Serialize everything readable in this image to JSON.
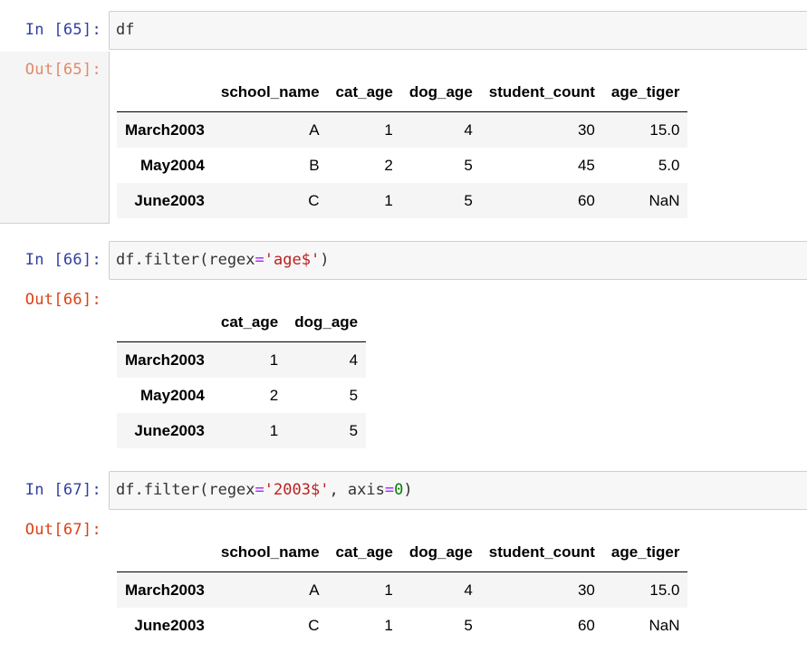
{
  "cells": [
    {
      "in_prompt": "In [65]:",
      "code_tokens": [
        {
          "text": "df",
          "kind": "plain"
        }
      ],
      "out_prompt": "Out[65]:",
      "table": {
        "columns": [
          "",
          "school_name",
          "cat_age",
          "dog_age",
          "student_count",
          "age_tiger"
        ],
        "rows": [
          [
            "March2003",
            "A",
            "1",
            "4",
            "30",
            "15.0"
          ],
          [
            "May2004",
            "B",
            "2",
            "5",
            "45",
            "5.0"
          ],
          [
            "June2003",
            "C",
            "1",
            "5",
            "60",
            "NaN"
          ]
        ]
      }
    },
    {
      "in_prompt": "In [66]:",
      "code_tokens": [
        {
          "text": "df.filter(regex",
          "kind": "plain"
        },
        {
          "text": "=",
          "kind": "op"
        },
        {
          "text": "'age$'",
          "kind": "str"
        },
        {
          "text": ")",
          "kind": "plain"
        }
      ],
      "out_prompt": "Out[66]:",
      "table": {
        "columns": [
          "",
          "cat_age",
          "dog_age"
        ],
        "rows": [
          [
            "March2003",
            "1",
            "4"
          ],
          [
            "May2004",
            "2",
            "5"
          ],
          [
            "June2003",
            "1",
            "5"
          ]
        ]
      }
    },
    {
      "in_prompt": "In [67]:",
      "code_tokens": [
        {
          "text": "df.filter(regex",
          "kind": "plain"
        },
        {
          "text": "=",
          "kind": "op"
        },
        {
          "text": "'2003$'",
          "kind": "str"
        },
        {
          "text": ", axis",
          "kind": "plain"
        },
        {
          "text": "=",
          "kind": "op"
        },
        {
          "text": "0",
          "kind": "num"
        },
        {
          "text": ")",
          "kind": "plain"
        }
      ],
      "out_prompt": "Out[67]:",
      "table": {
        "columns": [
          "",
          "school_name",
          "cat_age",
          "dog_age",
          "student_count",
          "age_tiger"
        ],
        "rows": [
          [
            "March2003",
            "A",
            "1",
            "4",
            "30",
            "15.0"
          ],
          [
            "June2003",
            "C",
            "1",
            "5",
            "60",
            "NaN"
          ]
        ]
      }
    }
  ]
}
